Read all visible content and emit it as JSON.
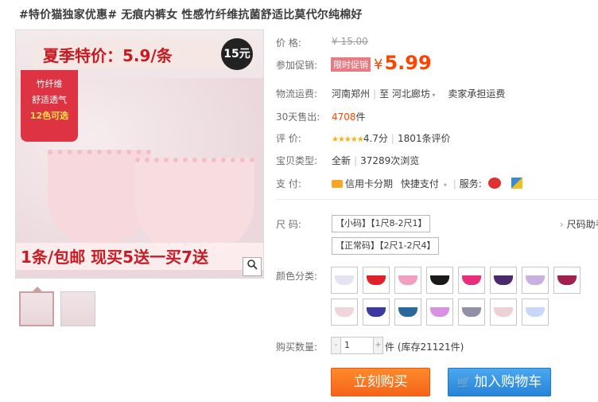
{
  "title": "#特价猫独家优惠# 无痕内裤女 性感竹纤维抗菌舒适比莫代尔纯棉好",
  "image": {
    "banner_top": "夏季特价：5.9/条",
    "banner_circle": "15元",
    "side_tag": [
      "竹纤维",
      "舒适透气",
      "12色可选"
    ],
    "banner_bottom": "1条/包邮  现买5送一买7送"
  },
  "price": {
    "label": "价    格:",
    "original": "¥ 15.00",
    "promo_label": "参加促销:",
    "promo_tag": "限时促销",
    "currency": "¥",
    "promo_value": "5.99"
  },
  "shipping": {
    "label": "物流运费:",
    "from": "河南郑州",
    "to_label": "至",
    "to": "河北廊坊",
    "note": "卖家承担运费"
  },
  "sales": {
    "label": "30天售出:",
    "count": "4708",
    "unit": "件"
  },
  "rating": {
    "label": "评    价:",
    "stars": "★★★★★",
    "score": "4.7分",
    "reviews": "1801条评价"
  },
  "type": {
    "label": "宝贝类型:",
    "value": "全新",
    "views": "37289次浏览"
  },
  "payment": {
    "label": "支    付:",
    "credit": "信用卡分期",
    "quick": "快捷支付",
    "service_label": "服务:"
  },
  "size": {
    "label": "尺    码:",
    "options": [
      "【小码】【1尺8-2尺1】",
      "【正常码】【2尺1-2尺4】"
    ],
    "guide": "尺码助手"
  },
  "color": {
    "label": "颜色分类:",
    "swatches": [
      "#e6e2f0",
      "#e0202a",
      "#f2a0c0",
      "#1a1a1a",
      "#e8307a",
      "#4a2a6a",
      "#c8b0e0",
      "#a02050",
      "#f0d6dc",
      "#3a3aa0",
      "#2a6a9a",
      "#d890e0",
      "#9090a8",
      "#ecd2d6",
      "#c8d8f8"
    ]
  },
  "quantity": {
    "label": "购买数量:",
    "minus": "-",
    "value": "1",
    "plus": "+",
    "stock": "件 (库存21121件)"
  },
  "buttons": {
    "buy": "立刻购买",
    "cart": "加入购物车"
  }
}
